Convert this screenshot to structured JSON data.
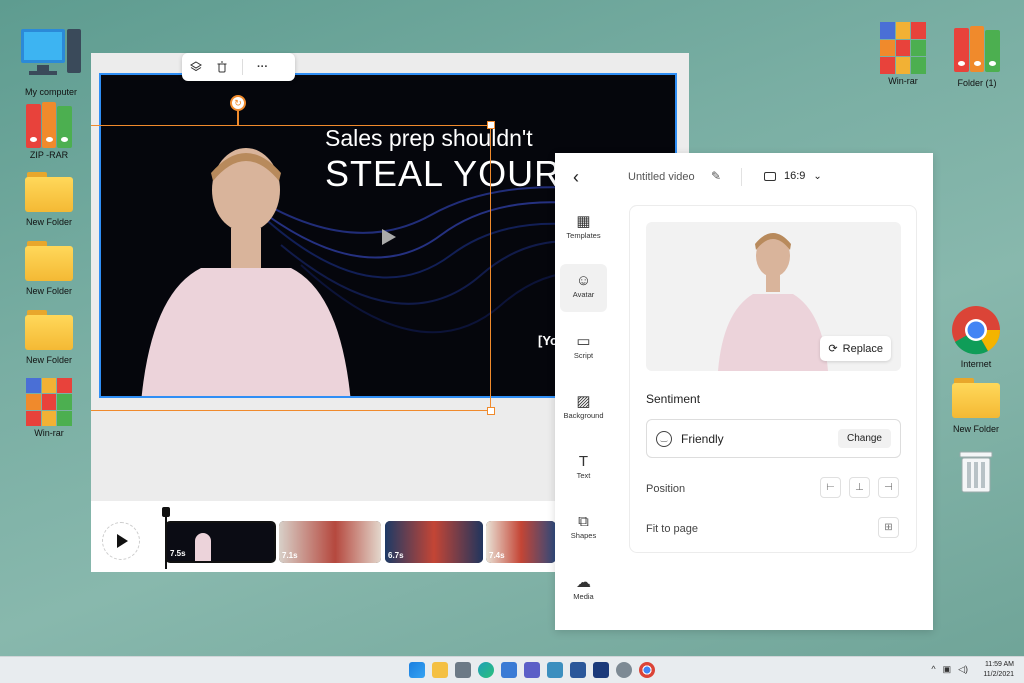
{
  "desktop": {
    "icons_left": [
      {
        "label": "My computer"
      },
      {
        "label": "ZIP -RAR"
      },
      {
        "label": "New Folder"
      },
      {
        "label": "New Folder"
      },
      {
        "label": "New Folder"
      },
      {
        "label": "Win-rar"
      }
    ],
    "icons_right": [
      {
        "label": "Win-rar"
      },
      {
        "label": "Folder (1)"
      },
      {
        "label": "Internet"
      },
      {
        "label": "New Folder"
      }
    ]
  },
  "editor": {
    "toolbar": {
      "layers_icon": "layers-icon",
      "delete_icon": "trash-icon",
      "more_label": "···"
    },
    "canvas": {
      "headline_line1": "Sales prep shouldn't",
      "headline_line2": "STEAL YOUR",
      "overflow_text": "[Yo"
    },
    "timeline": {
      "clips": [
        {
          "duration": "7.5s"
        },
        {
          "duration": "7.1s"
        },
        {
          "duration": "6.7s"
        },
        {
          "duration": "7.4s"
        }
      ]
    }
  },
  "panel": {
    "back_icon": "chevron-left-icon",
    "video_title": "Untitled video",
    "aspect_ratio": "16:9",
    "nav": [
      {
        "label": "Templates",
        "icon": "templates-icon"
      },
      {
        "label": "Avatar",
        "icon": "avatar-icon"
      },
      {
        "label": "Script",
        "icon": "script-icon"
      },
      {
        "label": "Background",
        "icon": "background-icon"
      },
      {
        "label": "Text",
        "icon": "text-icon"
      },
      {
        "label": "Shapes",
        "icon": "shapes-icon"
      },
      {
        "label": "Media",
        "icon": "media-icon"
      }
    ],
    "replace_label": "Replace",
    "sentiment_label": "Sentiment",
    "sentiment_value": "Friendly",
    "change_label": "Change",
    "position_label": "Position",
    "fit_label": "Fit to page"
  },
  "taskbar": {
    "time": "11:59 AM",
    "date": "11/2/2021"
  },
  "colors": {
    "selection": "#f08a2c",
    "canvas_border": "#2f8ef5"
  }
}
